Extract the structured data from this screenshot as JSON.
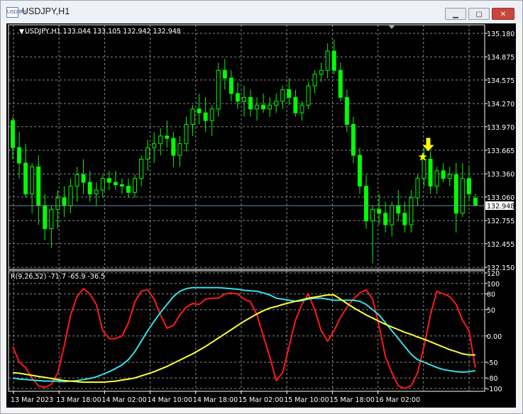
{
  "window": {
    "title": "USDJPY,H1",
    "icon_label": "USDJPY",
    "buttons": {
      "minimize": "minimize-icon",
      "maximize": "maximize-icon",
      "close": "close-icon"
    }
  },
  "colors": {
    "background": "#000000",
    "grid": "#8a8a8a",
    "axis": "#ffffff",
    "candle": "#00ff00",
    "price_line": "#6e8aa8",
    "rsi": "#ff1a1a",
    "cyan": "#33e0f0",
    "yellow": "#ffff33",
    "marker": "#ffff00"
  },
  "chart_data": [
    {
      "type": "candlestick",
      "title": "USDJPY,H1",
      "header": "USDJPY,H1  133.044 133.105 132.942 132.948",
      "ohlc": [
        133.044,
        133.105,
        132.942,
        132.948
      ],
      "current_price": "132.948",
      "current_price_value": 132.948,
      "y_ticks": [
        "135.180",
        "134.875",
        "134.575",
        "134.270",
        "133.970",
        "133.665",
        "133.360",
        "133.060",
        "132.755",
        "132.455",
        "132.150"
      ],
      "ylim": [
        132.15,
        135.18
      ],
      "x_ticks": [
        "13 Mar 2023",
        "13 Mar 18:00",
        "14 Mar 02:00",
        "14 Mar 10:00",
        "14 Mar 18:00",
        "15 Mar 02:00",
        "15 Mar 10:00",
        "15 Mar 18:00",
        "16 Mar 02:00"
      ],
      "grid": true,
      "candles": [
        [
          134.05,
          134.1,
          133.55,
          133.7
        ],
        [
          133.7,
          133.9,
          133.3,
          133.5
        ],
        [
          133.5,
          133.75,
          133.05,
          133.1
        ],
        [
          133.1,
          133.5,
          132.85,
          133.45
        ],
        [
          133.45,
          133.6,
          132.7,
          132.95
        ],
        [
          132.95,
          133.1,
          132.5,
          132.65
        ],
        [
          132.65,
          132.95,
          132.4,
          132.9
        ],
        [
          132.9,
          133.15,
          132.65,
          133.05
        ],
        [
          133.05,
          133.2,
          132.8,
          132.95
        ],
        [
          132.95,
          133.3,
          132.85,
          133.2
        ],
        [
          133.2,
          133.45,
          133.0,
          133.35
        ],
        [
          133.35,
          133.55,
          133.1,
          133.25
        ],
        [
          133.25,
          133.4,
          133.0,
          133.1
        ],
        [
          133.1,
          133.25,
          132.95,
          133.15
        ],
        [
          133.15,
          133.35,
          133.05,
          133.3
        ],
        [
          133.3,
          133.4,
          133.15,
          133.25
        ],
        [
          133.25,
          133.4,
          133.15,
          133.22
        ],
        [
          133.22,
          133.3,
          133.1,
          133.2
        ],
        [
          133.2,
          133.3,
          133.05,
          133.12
        ],
        [
          133.12,
          133.35,
          133.05,
          133.3
        ],
        [
          133.3,
          133.6,
          133.2,
          133.55
        ],
        [
          133.55,
          133.8,
          133.4,
          133.7
        ],
        [
          133.7,
          133.9,
          133.5,
          133.75
        ],
        [
          133.75,
          133.95,
          133.6,
          133.85
        ],
        [
          133.85,
          134.05,
          133.7,
          133.82
        ],
        [
          133.82,
          133.9,
          133.45,
          133.6
        ],
        [
          133.6,
          133.85,
          133.45,
          133.75
        ],
        [
          133.75,
          134.1,
          133.65,
          134.0
        ],
        [
          134.0,
          134.25,
          133.85,
          134.2
        ],
        [
          134.2,
          134.4,
          134.0,
          134.15
        ],
        [
          134.15,
          134.35,
          133.9,
          134.05
        ],
        [
          134.05,
          134.25,
          133.85,
          134.2
        ],
        [
          134.2,
          134.8,
          134.1,
          134.7
        ],
        [
          134.7,
          134.85,
          134.45,
          134.6
        ],
        [
          134.6,
          134.7,
          134.3,
          134.4
        ],
        [
          134.4,
          134.55,
          134.2,
          134.3
        ],
        [
          134.3,
          134.5,
          134.1,
          134.35
        ],
        [
          134.35,
          134.45,
          134.1,
          134.2
        ],
        [
          134.2,
          134.35,
          134.05,
          134.25
        ],
        [
          134.25,
          134.4,
          134.15,
          134.2
        ],
        [
          134.2,
          134.35,
          134.1,
          134.25
        ],
        [
          134.25,
          134.4,
          134.15,
          134.3
        ],
        [
          134.3,
          134.5,
          134.2,
          134.45
        ],
        [
          134.45,
          134.6,
          134.25,
          134.35
        ],
        [
          134.35,
          134.45,
          134.1,
          134.15
        ],
        [
          134.15,
          134.3,
          134.05,
          134.25
        ],
        [
          134.25,
          134.55,
          134.2,
          134.5
        ],
        [
          134.5,
          134.7,
          134.4,
          134.65
        ],
        [
          134.65,
          134.8,
          134.55,
          134.7
        ],
        [
          134.7,
          135.05,
          134.6,
          134.95
        ],
        [
          134.95,
          135.1,
          134.65,
          134.7
        ],
        [
          134.7,
          134.8,
          134.3,
          134.35
        ],
        [
          134.35,
          134.45,
          133.9,
          134.0
        ],
        [
          134.0,
          134.1,
          133.5,
          133.6
        ],
        [
          133.6,
          133.7,
          133.1,
          133.2
        ],
        [
          133.2,
          133.35,
          132.65,
          132.75
        ],
        [
          132.75,
          132.95,
          132.2,
          132.9
        ],
        [
          132.9,
          133.1,
          132.7,
          132.85
        ],
        [
          132.85,
          133.0,
          132.6,
          132.7
        ],
        [
          132.7,
          133.0,
          132.55,
          132.95
        ],
        [
          132.95,
          133.15,
          132.75,
          132.85
        ],
        [
          132.85,
          133.0,
          132.6,
          132.7
        ],
        [
          132.7,
          133.15,
          132.6,
          133.05
        ],
        [
          133.05,
          133.35,
          132.95,
          133.3
        ],
        [
          133.3,
          133.7,
          133.2,
          133.55
        ],
        [
          133.55,
          133.65,
          133.1,
          133.2
        ],
        [
          133.2,
          133.45,
          133.1,
          133.4
        ],
        [
          133.4,
          133.5,
          133.25,
          133.3
        ],
        [
          133.3,
          133.45,
          133.2,
          133.35
        ],
        [
          133.35,
          133.5,
          132.6,
          132.85
        ],
        [
          132.85,
          133.5,
          132.8,
          133.3
        ],
        [
          133.3,
          133.45,
          133.0,
          133.1
        ],
        [
          133.044,
          133.105,
          132.942,
          132.948
        ]
      ],
      "signal": {
        "arrow_icon": "down-arrow-icon",
        "star_icon": "star-icon",
        "at_index": 64,
        "price": 133.55
      }
    },
    {
      "type": "line",
      "title": "R(9,26,52) -71.7 -65.9 -36.5",
      "y_ticks": [
        "120",
        "100",
        "80",
        "50",
        "0.00",
        "-50",
        "-80",
        "-100"
      ],
      "ylim": [
        -100,
        120
      ],
      "series": [
        {
          "name": "-71.7",
          "color": "#ff1a1a",
          "values": [
            -20,
            -50,
            -60,
            -80,
            -95,
            -98,
            -92,
            -70,
            -20,
            40,
            75,
            90,
            80,
            60,
            10,
            -5,
            -5,
            0,
            25,
            65,
            85,
            88,
            70,
            40,
            15,
            20,
            40,
            55,
            62,
            60,
            70,
            72,
            72,
            80,
            82,
            80,
            70,
            65,
            40,
            0,
            -40,
            -85,
            -70,
            -20,
            30,
            60,
            80,
            50,
            10,
            -10,
            10,
            35,
            55,
            70,
            82,
            88,
            70,
            20,
            -40,
            -70,
            -95,
            -100,
            -95,
            -70,
            -20,
            40,
            85,
            80,
            75,
            60,
            30,
            10,
            -60
          ]
        },
        {
          "name": "-65.9",
          "color": "#33e0f0",
          "values": [
            -80,
            -82,
            -83,
            -84,
            -85,
            -86,
            -86,
            -86,
            -87,
            -86,
            -85,
            -83,
            -81,
            -78,
            -73,
            -68,
            -62,
            -55,
            -45,
            -30,
            -10,
            10,
            28,
            45,
            60,
            75,
            85,
            90,
            92,
            92,
            92,
            92,
            92,
            91,
            90,
            89,
            87,
            86,
            85,
            82,
            78,
            72,
            70,
            68,
            66,
            67,
            70,
            72,
            72,
            70,
            68,
            68,
            68,
            68,
            66,
            60,
            50,
            40,
            25,
            10,
            -5,
            -20,
            -35,
            -45,
            -50,
            -55,
            -60,
            -64,
            -66,
            -68,
            -69,
            -68,
            -66
          ]
        },
        {
          "name": "-36.5",
          "color": "#ffff33",
          "values": [
            -70,
            -71,
            -73,
            -75,
            -77,
            -79,
            -81,
            -83,
            -85,
            -86,
            -87,
            -88,
            -88,
            -88,
            -88,
            -87,
            -86,
            -84,
            -82,
            -80,
            -76,
            -72,
            -68,
            -63,
            -58,
            -52,
            -46,
            -40,
            -34,
            -27,
            -20,
            -12,
            -4,
            4,
            12,
            20,
            28,
            35,
            42,
            48,
            53,
            56,
            60,
            63,
            66,
            69,
            72,
            74,
            76,
            78,
            78,
            70,
            62,
            54,
            47,
            40,
            34,
            28,
            22,
            17,
            12,
            7,
            3,
            -2,
            -6,
            -11,
            -16,
            -21,
            -26,
            -30,
            -34,
            -36,
            -36
          ]
        }
      ]
    }
  ]
}
